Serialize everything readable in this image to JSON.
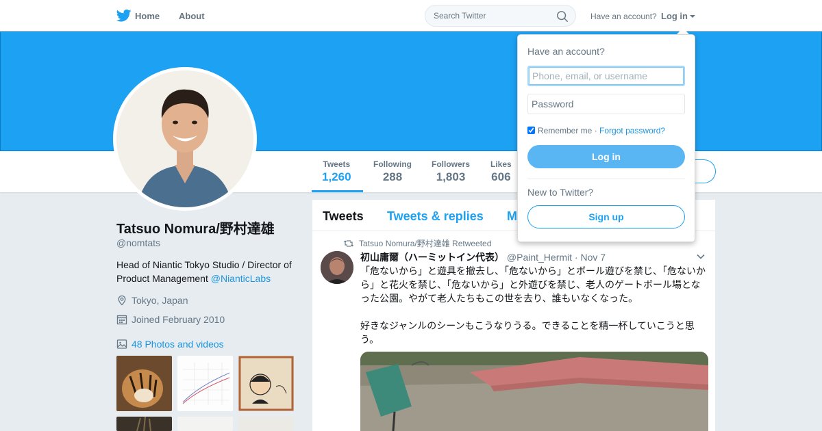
{
  "topnav": {
    "home_label": "Home",
    "about_label": "About",
    "search_placeholder": "Search Twitter",
    "have_account": "Have an account?",
    "login_label": "Log in"
  },
  "profile": {
    "name": "Tatsuo Nomura/野村達雄",
    "handle": "@nomtats",
    "bio_text": "Head of Niantic Tokyo Studio / Director of Product Management",
    "bio_link": "@NianticLabs",
    "location": "Tokyo, Japan",
    "joined": "Joined February 2010",
    "photos_label": "48 Photos and videos"
  },
  "stats": [
    {
      "label": "Tweets",
      "value": "1,260"
    },
    {
      "label": "Following",
      "value": "288"
    },
    {
      "label": "Followers",
      "value": "1,803"
    },
    {
      "label": "Likes",
      "value": "606"
    }
  ],
  "timeline": {
    "tabs": [
      "Tweets",
      "Tweets & replies",
      "M"
    ],
    "retweet_line": "Tatsuo Nomura/野村達雄 Retweeted",
    "tweet": {
      "fullname": "初山庸爾（ハーミットイン代表）",
      "username": "@Paint_Hermit",
      "dot": "·",
      "time": "Nov 7",
      "text": "「危ないから」と遊具を撤去し、「危ないから」とボール遊びを禁じ、「危ないから」と花火を禁じ、「危ないから」と外遊びを禁じ、老人のゲートボール場となった公園。やがて老人たちもこの世を去り、誰もいなくなった。\n\n好きなジャンルのシーンもこうなりうる。できることを精一杯していこうと思う。"
    }
  },
  "dropdown": {
    "title": "Have an account?",
    "username_placeholder": "Phone, email, or username",
    "password_placeholder": "Password",
    "remember_label": "Remember me",
    "separator": "·",
    "forgot_label": "Forgot password?",
    "login_button": "Log in",
    "new_label": "New to Twitter?",
    "signup_button": "Sign up"
  },
  "colors": {
    "brand": "#1da1f2",
    "link": "#1b95e0",
    "text_secondary": "#657786"
  }
}
